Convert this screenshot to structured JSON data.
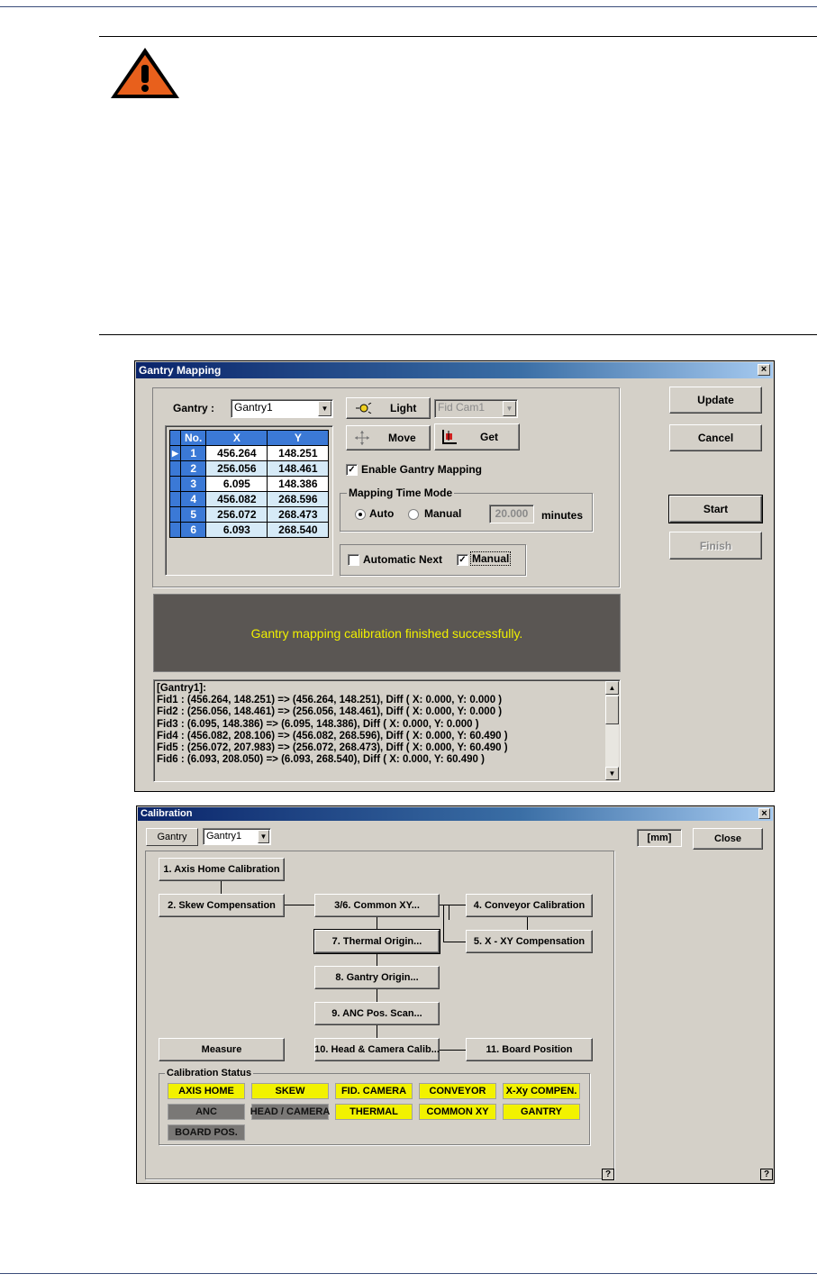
{
  "gantry_mapping": {
    "title": "Gantry Mapping",
    "close_glyph": "×",
    "gantry_label": "Gantry :",
    "gantry_value": "Gantry1",
    "light_label": "Light",
    "fidcam_value": "Fid Cam1",
    "move_label": "Move",
    "get_label": "Get",
    "table_headers": [
      "No.",
      "X",
      "Y"
    ],
    "table_rows": [
      {
        "no": "1",
        "x": "456.264",
        "y": "148.251"
      },
      {
        "no": "2",
        "x": "256.056",
        "y": "148.461"
      },
      {
        "no": "3",
        "x": "6.095",
        "y": "148.386"
      },
      {
        "no": "4",
        "x": "456.082",
        "y": "268.596"
      },
      {
        "no": "5",
        "x": "256.072",
        "y": "268.473"
      },
      {
        "no": "6",
        "x": "6.093",
        "y": "268.540"
      }
    ],
    "enable_mapping_label": "Enable Gantry Mapping",
    "enable_mapping_checked": true,
    "time_mode_label": "Mapping Time Mode",
    "auto_label": "Auto",
    "manual_label": "Manual",
    "time_mode_selected": "Auto",
    "minutes_value": "20.000",
    "minutes_label": "minutes",
    "automatic_next_label": "Automatic Next",
    "automatic_next_checked": false,
    "manual_check_label": "Manual",
    "manual_checked": true,
    "update_label": "Update",
    "cancel_label": "Cancel",
    "start_label": "Start",
    "finish_label": "Finish",
    "message": "Gantry mapping calibration finished successfully.",
    "log_lines": [
      "[Gantry1]:",
      "Fid1 : (456.264, 148.251) => (456.264, 148.251),  Diff ( X: 0.000, Y: 0.000 )",
      "Fid2 : (256.056, 148.461) => (256.056, 148.461),  Diff ( X: 0.000, Y: 0.000 )",
      "Fid3 : (6.095, 148.386) => (6.095, 148.386),  Diff ( X: 0.000, Y: 0.000 )",
      "Fid4 : (456.082, 208.106) => (456.082, 268.596),  Diff ( X: 0.000, Y: 60.490 )",
      "Fid5 : (256.072, 207.983) => (256.072, 268.473),  Diff ( X: 0.000, Y: 60.490 )",
      "Fid6 : (6.093, 208.050) => (6.093, 268.540),  Diff ( X: 0.000, Y: 60.490 )"
    ]
  },
  "calibration": {
    "title": "Calibration",
    "close_glyph": "×",
    "gantry_tab": "Gantry",
    "gantry_value": "Gantry1",
    "unit": "[mm]",
    "close_label": "Close",
    "steps": {
      "axis_home": "1. Axis Home Calibration",
      "skew": "2. Skew Compensation",
      "common_xy": "3/6. Common XY...",
      "conveyor": "4. Conveyor Calibration",
      "x_xy": "5. X - XY Compensation",
      "thermal": "7. Thermal Origin...",
      "gantry_origin": "8. Gantry Origin...",
      "anc_scan": "9. ANC Pos. Scan...",
      "head_camera": "10. Head & Camera Calib...",
      "board_position": "11. Board Position",
      "measure": "Measure"
    },
    "status_label": "Calibration Status",
    "status_items": [
      {
        "label": "AXIS HOME",
        "state": "on"
      },
      {
        "label": "SKEW",
        "state": "on"
      },
      {
        "label": "FID. CAMERA",
        "state": "on"
      },
      {
        "label": "CONVEYOR",
        "state": "on"
      },
      {
        "label": "X-Xy COMPEN.",
        "state": "on"
      },
      {
        "label": "ANC",
        "state": "off"
      },
      {
        "label": "HEAD / CAMERA",
        "state": "off"
      },
      {
        "label": "THERMAL",
        "state": "on"
      },
      {
        "label": "COMMON XY",
        "state": "on"
      },
      {
        "label": "GANTRY",
        "state": "on"
      },
      {
        "label": "BOARD POS.",
        "state": "off"
      }
    ],
    "help_glyph": "?"
  },
  "colors": {
    "warning_orange": "#e8601c",
    "status_on": "#f2f200",
    "status_off": "#7a7876",
    "message_text": "#f0f000",
    "title_bar": "#0a246a"
  },
  "icons": [
    "warning-icon",
    "light-icon",
    "move-icon",
    "get-icon"
  ]
}
